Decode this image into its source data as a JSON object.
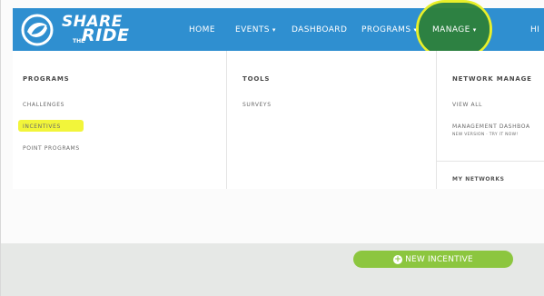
{
  "brand": {
    "name_top": "SHARE",
    "name_small": "THE",
    "name_bottom": "RIDE",
    "logo_icon": "swirl-logo-icon",
    "color": "#2f8fd0"
  },
  "nav": {
    "home": "HOME",
    "events": "EVENTS",
    "dashboard": "DASHBOARD",
    "programs": "PROGRAMS",
    "manage": "MANAGE",
    "hi": "HI",
    "caret": "▾"
  },
  "dropdown": {
    "programs": {
      "title": "PROGRAMS",
      "items": [
        "CHALLENGES",
        "INCENTIVES",
        "POINT PROGRAMS"
      ]
    },
    "tools": {
      "title": "TOOLS",
      "items": [
        "SURVEYS"
      ]
    },
    "network": {
      "title": "NETWORK MANAGE",
      "items": [
        "VIEW ALL",
        "MANAGEMENT DASHBOA"
      ],
      "sub": "NEW VERSION · TRY IT NOW!",
      "my_networks": "MY NETWORKS"
    }
  },
  "actions": {
    "new_incentive": "NEW INCENTIVE",
    "plus_icon": "+"
  },
  "colors": {
    "highlight": "#f2f53a",
    "manage_highlight": "#2c7f3d",
    "button": "#8cc63f"
  }
}
